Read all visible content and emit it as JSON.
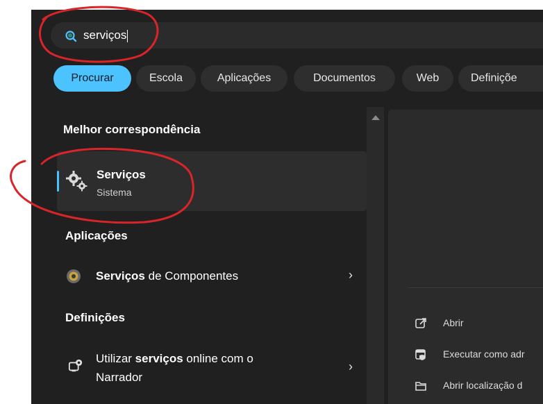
{
  "search": {
    "query": "serviços"
  },
  "tabs": [
    {
      "label": "Procurar",
      "active": true
    },
    {
      "label": "Escola"
    },
    {
      "label": "Aplicações"
    },
    {
      "label": "Documentos"
    },
    {
      "label": "Web"
    },
    {
      "label": "Definiçõe"
    }
  ],
  "best_match": {
    "heading": "Melhor correspondência",
    "title": "Serviços",
    "subtitle": "Sistema"
  },
  "apps": {
    "heading": "Aplicações",
    "item_bold": "Serviços",
    "item_rest": " de Componentes"
  },
  "settings": {
    "heading": "Definições",
    "line1_pre": "Utilizar ",
    "line1_bold": "serviços",
    "line1_post": " online com o",
    "line2": "Narrador"
  },
  "actions": [
    {
      "label": "Abrir"
    },
    {
      "label": "Executar como adr"
    },
    {
      "label": "Abrir localização d"
    }
  ],
  "colors": {
    "accent": "#4cc2ff",
    "background": "#202020",
    "annotation": "#d9252a"
  }
}
